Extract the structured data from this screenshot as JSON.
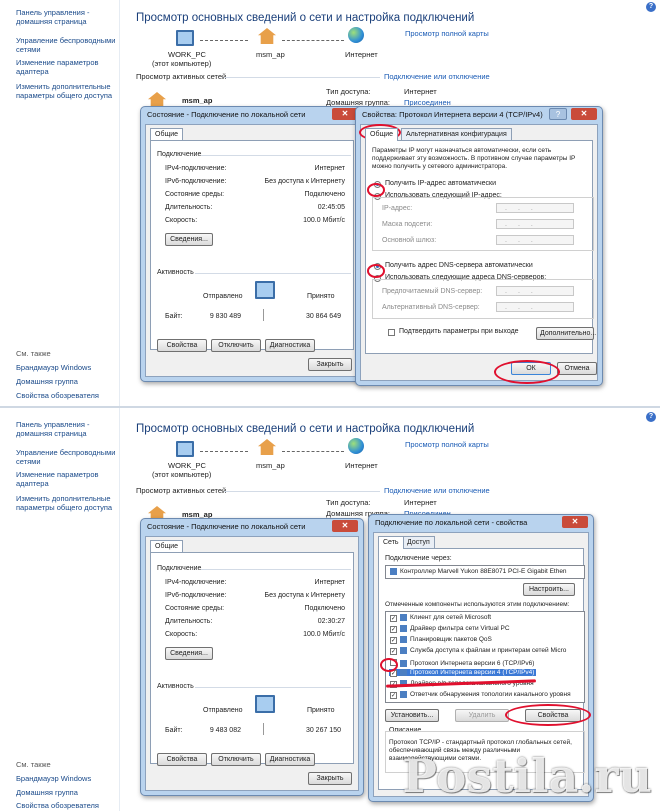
{
  "sidebar": {
    "home": "Панель управления - домашняя страница",
    "items": [
      "Управление беспроводными сетями",
      "Изменение параметров адаптера",
      "Изменить дополнительные параметры общего доступа"
    ],
    "see_also": "См. также",
    "footer": [
      "Брандмауэр Windows",
      "Домашняя группа",
      "Свойства обозревателя"
    ]
  },
  "network_center": {
    "title": "Просмотр основных сведений о сети и настройка подключений",
    "full_map": "Просмотр полной карты",
    "node_pc": "WORK_PC",
    "node_pc_sub": "(этот компьютер)",
    "node_ap": "msm_ap",
    "node_internet": "Интернет",
    "active_networks": "Просмотр активных сетей",
    "connect_disconnect": "Подключение или отключение",
    "network_name": "msm_ap",
    "access_type_label": "Тип доступа:",
    "access_type_value": "Интернет",
    "homegroup_label": "Домашняя группа:",
    "homegroup_value": "Присоединен"
  },
  "status_dialog": {
    "title": "Состояние - Подключение по локальной сети",
    "tab": "Общие",
    "connection": "Подключение",
    "rows": [
      {
        "label": "IPv4-подключение:",
        "value": "Интернет"
      },
      {
        "label": "IPv6-подключение:",
        "value": "Без доступа к Интернету"
      },
      {
        "label": "Состояние среды:",
        "value": "Подключено"
      },
      {
        "label": "Длительность:",
        "value": "02:45:05"
      },
      {
        "label": "Скорость:",
        "value": "100.0 Мбит/с"
      }
    ],
    "details_btn": "Сведения...",
    "activity": "Активность",
    "sent": "Отправлено",
    "received": "Принято",
    "bytes_label": "Байт:",
    "bytes_sent": "9 830 489",
    "bytes_received": "30 864 649",
    "properties_btn": "Свойства",
    "disable_btn": "Отключить",
    "diagnose_btn": "Диагностика",
    "close_btn": "Закрыть"
  },
  "status_dialog_2": {
    "duration": "02:30:27",
    "bytes_sent": "9 483 082",
    "bytes_received": "30 267 150"
  },
  "ipv4_dialog": {
    "title": "Свойства: Протокол Интернета версии 4 (TCP/IPv4)",
    "tab_general": "Общие",
    "tab_alt": "Альтернативная конфигурация",
    "desc": "Параметры IP могут назначаться автоматически, если сеть поддерживает эту возможность. В противном случае параметры IP можно получить у сетевого администратора.",
    "auto_ip": "Получить IP-адрес автоматически",
    "manual_ip": "Использовать следующий IP-адрес:",
    "ip_addr": "IP-адрес:",
    "mask": "Маска подсети:",
    "gateway": "Основной шлюз:",
    "auto_dns": "Получить адрес DNS-сервера автоматически",
    "manual_dns": "Использовать следующие адреса DNS-серверов:",
    "pref_dns": "Предпочитаемый DNS-сервер:",
    "alt_dns": "Альтернативный DNS-сервер:",
    "validate": "Подтвердить параметры при выходе",
    "advanced_btn": "Дополнительно...",
    "ok_btn": "ОК",
    "cancel_btn": "Отмена"
  },
  "lan_props": {
    "title": "Подключение по локальной сети - свойства",
    "tab_net": "Сеть",
    "tab_access": "Доступ",
    "connect_via": "Подключение через:",
    "adapter": "Контроллер Marvell Yukon 88E8071 PCI-E Gigabit Ethen",
    "configure_btn": "Настроить...",
    "components_label": "Отмеченные компоненты используются этим подключением:",
    "components": [
      "Клиент для сетей Microsoft",
      "Драйвер фильтра сети Virtual PC",
      "Планировщик пакетов QoS",
      "Служба доступа к файлам и принтерам сетей Micro",
      "Протокол Интернета версии 6 (TCP/IPv6)",
      "Протокол Интернета версии 4 (TCP/IPv4)",
      "Драйвер в/в тополога канального уровня",
      "Ответчик обнаружения топологии канального уровня"
    ],
    "install_btn": "Установить...",
    "remove_btn": "Удалить",
    "properties_btn": "Свойства",
    "description_label": "Описание",
    "description": "Протокол TCP/IP - стандартный протокол глобальных сетей, обеспечивающий связь между различными взаимодействующими сетями."
  },
  "watermark": "Postila.ru",
  "colors": {
    "highlight_ring": "#e0102e",
    "link": "#1a5bb5",
    "title": "#1a3f7a"
  }
}
